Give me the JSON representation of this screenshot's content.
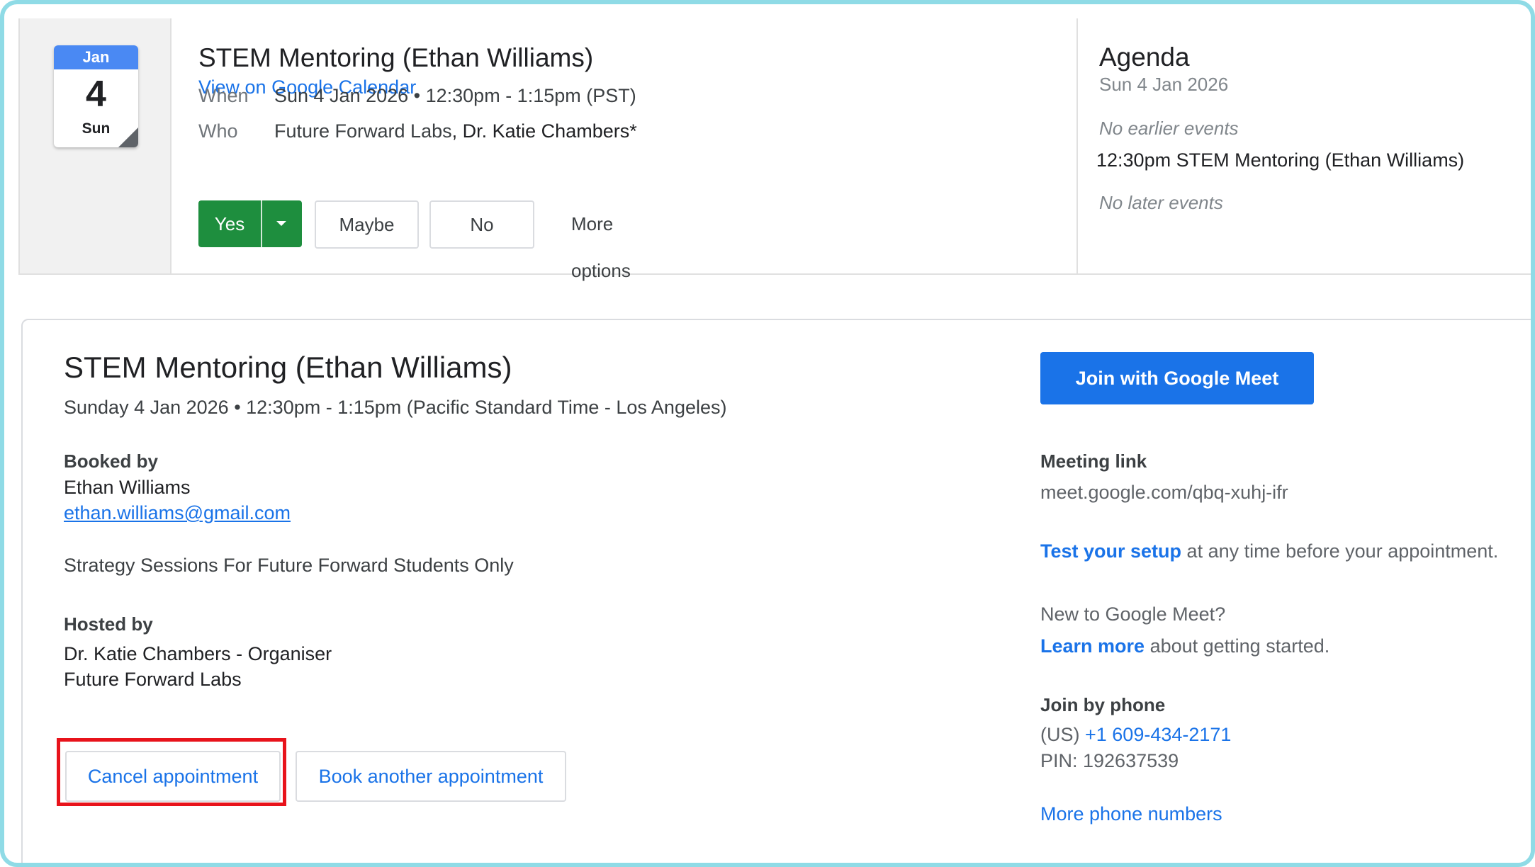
{
  "invite": {
    "calendar_icon": {
      "month": "Jan",
      "day": "4",
      "weekday": "Sun"
    },
    "title": "STEM Mentoring (Ethan Williams)",
    "view_link": "View on Google Calendar",
    "when_label": "When",
    "when_value": "Sun 4 Jan 2026 • 12:30pm - 1:15pm (PST)",
    "who_label": "Who",
    "who_org": "Future Forward Labs",
    "who_sep": ",",
    "who_person": "Dr. Katie Chambers*",
    "rsvp": {
      "yes": "Yes",
      "maybe": "Maybe",
      "no": "No",
      "more": "More options"
    },
    "colors": {
      "yes_bg": "#1e8e3e",
      "link": "#1a73e8"
    }
  },
  "agenda": {
    "title": "Agenda",
    "date": "Sun 4 Jan 2026",
    "no_earlier": "No earlier events",
    "event": "12:30pm STEM Mentoring (Ethan Williams)",
    "no_later": "No later events"
  },
  "appointment": {
    "title": "STEM Mentoring (Ethan Williams)",
    "when": "Sunday 4 Jan 2026 • 12:30pm - 1:15pm (Pacific Standard Time - Los Angeles)",
    "booked_by_label": "Booked by",
    "booked_by_name": "Ethan Williams",
    "booked_by_email": "ethan.williams@gmail.com",
    "description": "Strategy Sessions For Future Forward Students Only",
    "hosted_by_label": "Hosted by",
    "host_line1": "Dr. Katie Chambers - Organiser",
    "host_line2": "Future Forward Labs",
    "cancel_button": "Cancel appointment",
    "book_button": "Book another appointment",
    "join_meet_button": "Join with Google Meet",
    "meeting_link_label": "Meeting link",
    "meeting_link": "meet.google.com/qbq-xuhj-ifr",
    "test_setup_link": "Test your setup",
    "test_setup_rest": " at any time before your appointment.",
    "new_to_meet": "New to Google Meet?",
    "learn_more_link": "Learn more",
    "learn_more_rest": " about getting started.",
    "join_phone_label": "Join by phone",
    "phone_country": "(US) ",
    "phone_number": "+1 609-434-2171",
    "pin": "PIN: 192637539",
    "more_numbers": "More phone numbers",
    "colors": {
      "primary": "#1a73e8",
      "highlight": "#e8131b"
    }
  }
}
